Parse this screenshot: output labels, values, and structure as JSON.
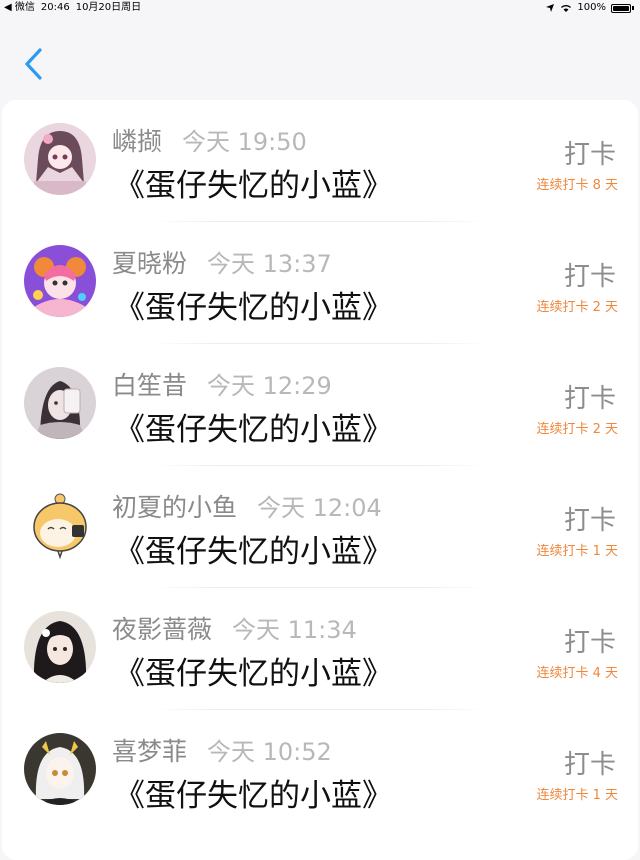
{
  "status_bar": {
    "back_app": "◀ 微信",
    "time": "20:46",
    "date": "10月20日周日",
    "battery": "100%"
  },
  "list": [
    {
      "nickname": "嶙撷",
      "time": "今天 19:50",
      "title": "《蛋仔失忆的小蓝》",
      "checkin_label": "打卡",
      "streak": "连续打卡 8 天"
    },
    {
      "nickname": "夏晓粉",
      "time": "今天 13:37",
      "title": "《蛋仔失忆的小蓝》",
      "checkin_label": "打卡",
      "streak": "连续打卡 2 天"
    },
    {
      "nickname": "白笙昔",
      "time": "今天 12:29",
      "title": "《蛋仔失忆的小蓝》",
      "checkin_label": "打卡",
      "streak": "连续打卡 2 天"
    },
    {
      "nickname": "初夏的小鱼",
      "time": "今天 12:04",
      "title": "《蛋仔失忆的小蓝》",
      "checkin_label": "打卡",
      "streak": "连续打卡 1 天"
    },
    {
      "nickname": "夜影蔷薇",
      "time": "今天 11:34",
      "title": "《蛋仔失忆的小蓝》",
      "checkin_label": "打卡",
      "streak": "连续打卡 4 天"
    },
    {
      "nickname": "喜梦菲",
      "time": "今天 10:52",
      "title": "《蛋仔失忆的小蓝》",
      "checkin_label": "打卡",
      "streak": "连续打卡 1 天"
    }
  ],
  "colors": {
    "accent_blue": "#2b9af3",
    "streak_orange": "#f0873c",
    "background": "#f6f6f8"
  }
}
